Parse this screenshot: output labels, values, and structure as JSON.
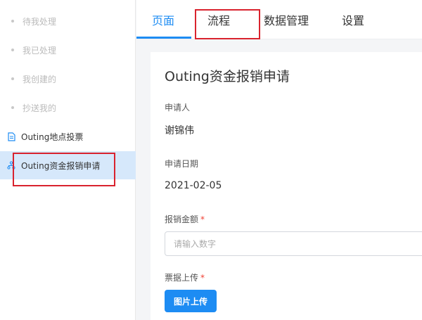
{
  "sidebar": {
    "items": [
      {
        "label": "待我处理"
      },
      {
        "label": "我已处理"
      },
      {
        "label": "我创建的"
      },
      {
        "label": "抄送我的"
      },
      {
        "label": "Outing地点投票",
        "icon": "document-icon"
      },
      {
        "label": "Outing资金报销申请",
        "icon": "flow-icon"
      }
    ]
  },
  "tabs": [
    "页面",
    "流程",
    "数据管理",
    "设置"
  ],
  "form": {
    "title": "Outing资金报销申请",
    "applicant_label": "申请人",
    "applicant_value": "谢锦伟",
    "date_label": "申请日期",
    "date_value": "2021-02-05",
    "amount_label": "报销金额",
    "amount_placeholder": "请输入数字",
    "receipt_label": "票据上传",
    "required_mark": "*",
    "upload_button": "图片上传"
  },
  "colors": {
    "accent": "#1d8cf3",
    "highlight_box": "#d9232e",
    "required": "#f04134",
    "active_sidebar_bg": "#d6e8fb"
  }
}
